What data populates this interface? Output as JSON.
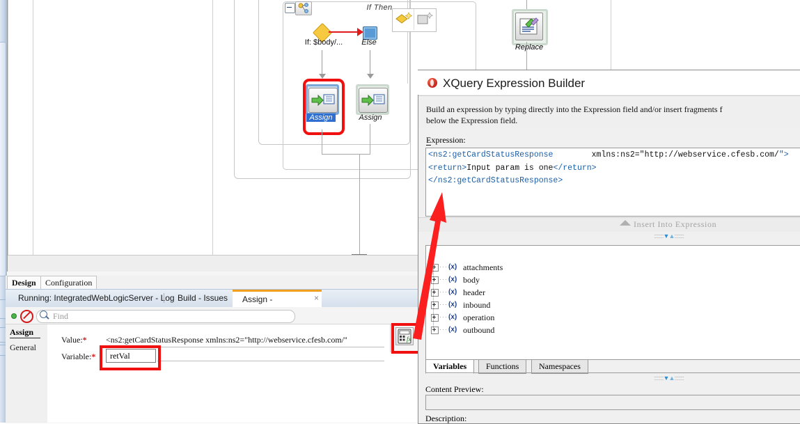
{
  "ide": {
    "design_tabs": [
      {
        "label": "Design",
        "active": true
      },
      {
        "label": "Configuration",
        "active": false
      }
    ],
    "dock_tabs": [
      {
        "label": "Running: IntegratedWebLogicServer - Log",
        "active": false
      },
      {
        "label": "Build - Issues",
        "active": false
      },
      {
        "label": "Assign - Properties",
        "active": true,
        "closable": true
      }
    ],
    "dock_close_glyph": "×",
    "find": {
      "placeholder": "Find",
      "icon": "search-icon",
      "status_dot": "running-indicator",
      "stop_icon": "stop-icon"
    },
    "properties": {
      "sidebar": [
        {
          "label": "Assign",
          "active": true
        },
        {
          "label": "General",
          "active": false
        }
      ],
      "fields": [
        {
          "label": "Value:",
          "required_marker": "*",
          "value": "<ns2:getCardStatusResponse xmlns:ns2=\"http://webservice.cfesb.com/\"",
          "button": {
            "name": "xquery-expression-button",
            "glyph": "ƒx",
            "dropdown": true
          },
          "highlighted": true
        },
        {
          "label": "Variable:",
          "required_marker": "*",
          "value": "retVal",
          "highlighted": true
        }
      ]
    }
  },
  "diagram": {
    "container_label": "If Then",
    "nodes": [
      {
        "name": "if-condition",
        "label": "If: $body/...",
        "icon": "diamond-icon"
      },
      {
        "name": "else-branch",
        "label": "Else",
        "icon": "square-icon"
      },
      {
        "name": "assign-then",
        "label": "Assign",
        "icon": "assign-icon",
        "selected": true,
        "highlighted": true
      },
      {
        "name": "assign-else",
        "label": "Assign",
        "icon": "assign-icon",
        "selected": false
      },
      {
        "name": "replace",
        "label": "Replace",
        "icon": "replace-icon"
      }
    ],
    "palette": [
      {
        "name": "add-condition-icon",
        "glyph": "diamond-plus"
      },
      {
        "name": "add-activity-icon",
        "glyph": "square-plus"
      }
    ]
  },
  "dialog": {
    "title": "XQuery Expression Builder",
    "title_icon": "xquery-icon",
    "description_line1": "Build an expression by typing directly into the Expression field and/or insert fragments f",
    "description_line2": "below the Expression field.",
    "expression_label": "Expression:",
    "expression_lines": [
      {
        "blue_a": "<ns2:getCardStatusResponse",
        "gap": "        ",
        "black": "xmlns:ns2=\"http://webservice.cfesb.com/",
        "blue_b": "\">"
      },
      {
        "blue_a": "<return>",
        "black": "Input param is one",
        "blue_b": "</return>"
      },
      {
        "blue_a": "</ns2:getCardStatusResponse>",
        "black": "",
        "blue_b": ""
      }
    ],
    "insert_button": {
      "label": "Insert Into Expression",
      "icon": "caret-up-icon",
      "enabled": false
    },
    "tree_items": [
      {
        "label": "attachments",
        "icon": "xml-var-icon",
        "expandable": true
      },
      {
        "label": "body",
        "icon": "xml-var-icon",
        "expandable": true
      },
      {
        "label": "header",
        "icon": "xml-var-icon",
        "expandable": true
      },
      {
        "label": "inbound",
        "icon": "xml-var-icon",
        "expandable": true
      },
      {
        "label": "operation",
        "icon": "xml-var-icon",
        "expandable": true
      },
      {
        "label": "outbound",
        "icon": "xml-var-icon",
        "expandable": true
      }
    ],
    "tabs": [
      {
        "label": "Variables",
        "active": true
      },
      {
        "label": "Functions",
        "active": false
      },
      {
        "label": "Namespaces",
        "active": false
      }
    ],
    "content_preview_label": "Content Preview:",
    "content_preview_value": "",
    "description_label": "Description:"
  },
  "colors": {
    "accent_blue": "#1b5fa8",
    "annotation_red": "#f01010",
    "tab_active_orange": "#f0a01e",
    "selection_blue": "#2f6fd0"
  }
}
